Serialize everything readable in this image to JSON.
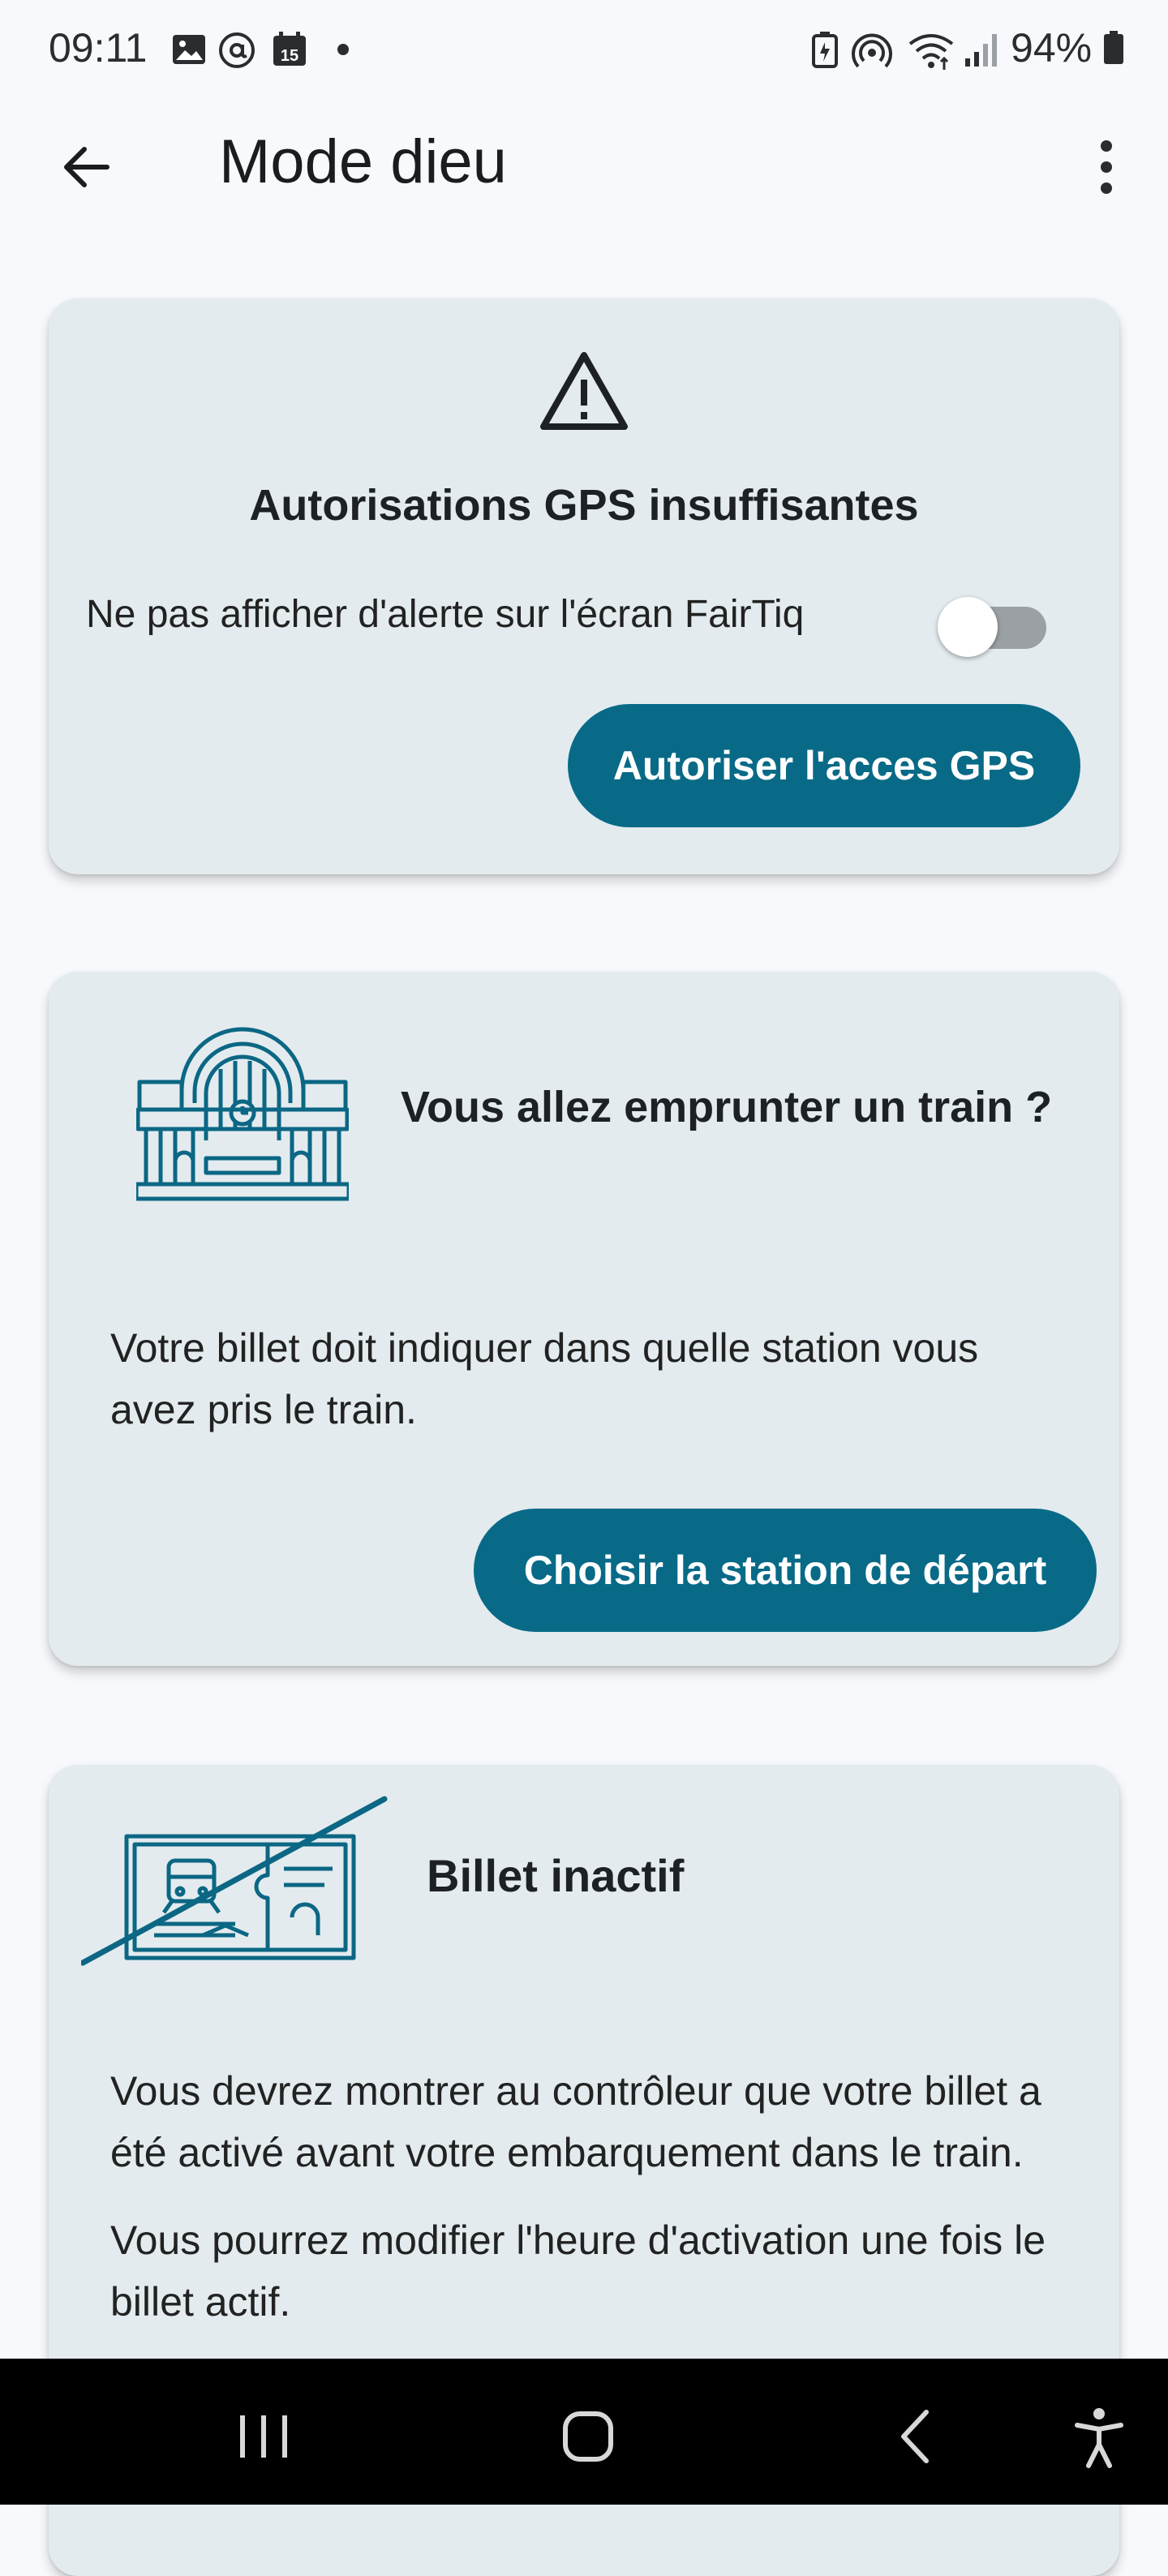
{
  "status_bar": {
    "time": "09:11",
    "battery": "94%",
    "calendar_day": "15",
    "icons_left": [
      "gallery-icon",
      "at-sign-icon",
      "calendar-icon",
      "dot-icon"
    ],
    "icons_right": [
      "battery-saver-icon",
      "hotspot-icon",
      "wifi-icon",
      "signal-icon",
      "battery-icon"
    ]
  },
  "app_bar": {
    "title": "Mode dieu"
  },
  "gps_card": {
    "title": "Autorisations GPS insuffisantes",
    "toggle_label": "Ne pas afficher d'alerte sur l'écran FairTiq",
    "toggle_on": false,
    "button_label": "Autoriser l'acces GPS"
  },
  "train_card": {
    "title": "Vous allez emprunter un train ?",
    "text": "Votre billet doit indiquer dans quelle station vous avez pris le train.",
    "button_label": "Choisir la station de départ"
  },
  "ticket_card": {
    "title": "Billet inactif",
    "paragraph1": "Vous devrez montrer au contrôleur que votre billet a été activé avant votre embarquement dans le train.",
    "paragraph2": "Vous pourrez modifier l'heure d'activation une fois le billet actif."
  },
  "colors": {
    "primary": "#086a87",
    "card_bg": "#e3ebef",
    "page_bg": "#f7f9fc"
  }
}
